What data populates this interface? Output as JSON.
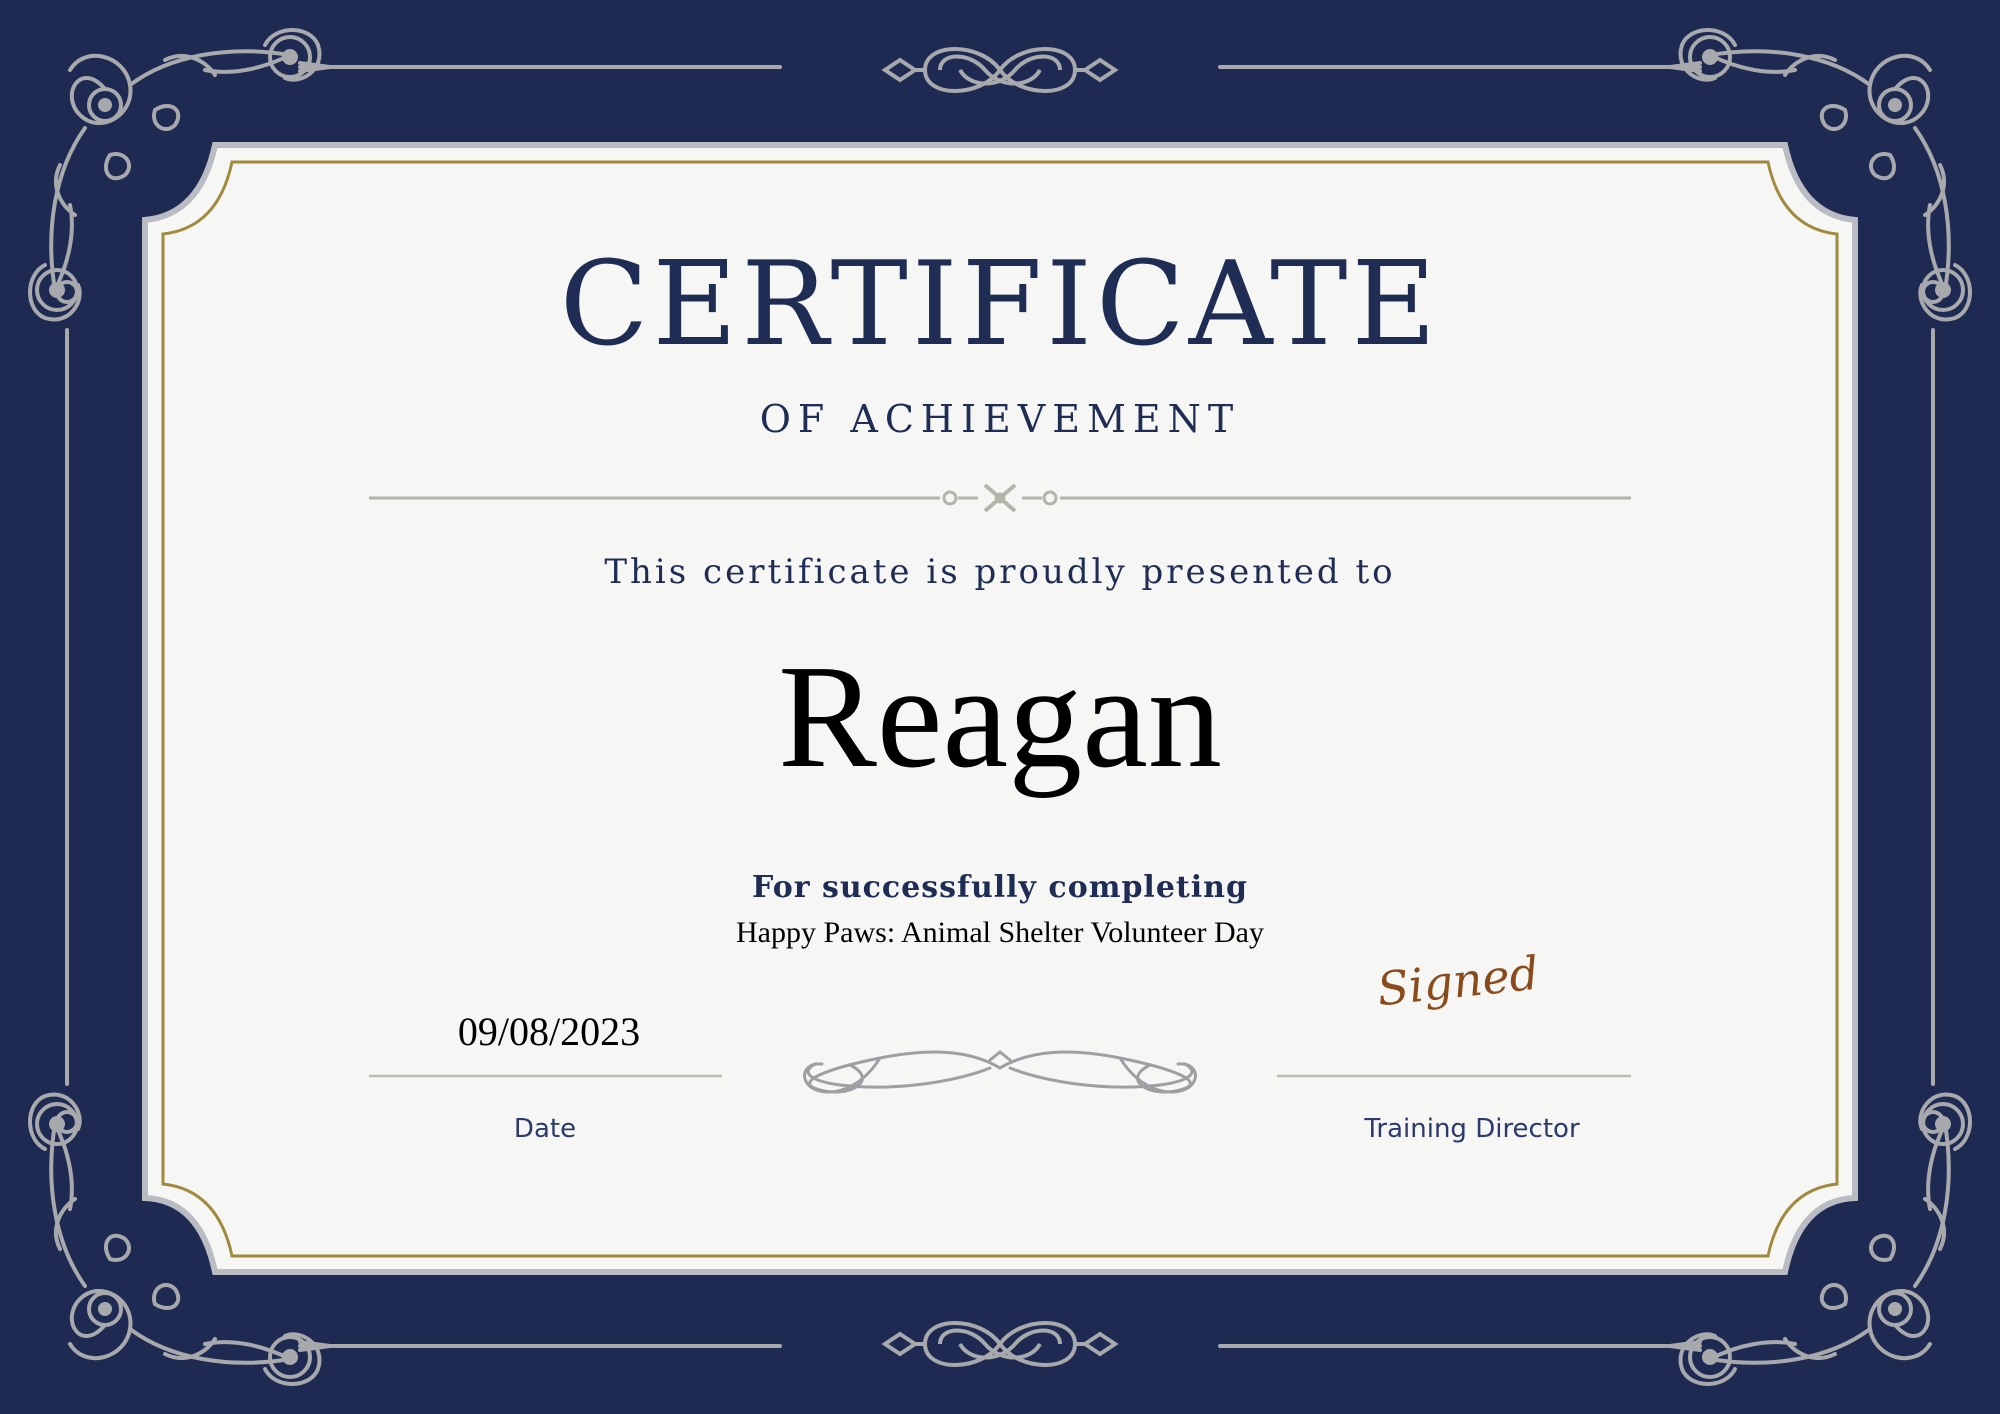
{
  "certificate": {
    "title": "CERTIFICATE",
    "subtitle": "OF ACHIEVEMENT",
    "presented_text": "This certificate is proudly presented to",
    "recipient_name": "Reagan",
    "for_text": "For successfully completing",
    "event_name": "Happy Paws: Animal Shelter Volunteer Day",
    "date_value": "09/08/2023",
    "date_label": "Date",
    "signature_text": "Signed",
    "signature_label": "Training Director"
  },
  "colors": {
    "background_navy": "#1e2a52",
    "paper": "#f6f6f4",
    "gold_border": "#a08a3e",
    "ornament_silver": "#a7a9ad",
    "heading_text": "#1f2d55",
    "signature_ink": "#8a4a1c"
  },
  "icons": [
    "corner-flourish-icon",
    "knot-ornament-icon",
    "center-divider-ornament-icon",
    "scroll-flourish-icon"
  ]
}
